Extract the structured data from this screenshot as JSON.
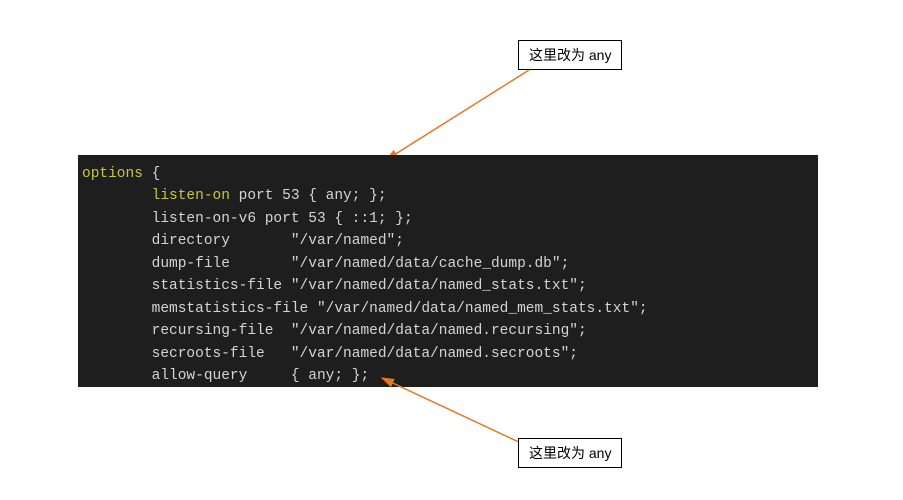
{
  "annotations": {
    "top": "这里改为 any",
    "bottom": "这里改为 any"
  },
  "code": {
    "options": "options",
    "brace_open": " {",
    "line1_key": "        listen-on",
    "line1_rest": " port 53 { any; };",
    "line2": "        listen-on-v6 port 53 { ::1; };",
    "line3": "        directory       \"/var/named\";",
    "line4": "        dump-file       \"/var/named/data/cache_dump.db\";",
    "line5": "        statistics-file \"/var/named/data/named_stats.txt\";",
    "line6": "        memstatistics-file \"/var/named/data/named_mem_stats.txt\";",
    "line7": "        recursing-file  \"/var/named/data/named.recursing\";",
    "line8": "        secroots-file   \"/var/named/data/named.secroots\";",
    "line9": "        allow-query     { any; };"
  }
}
